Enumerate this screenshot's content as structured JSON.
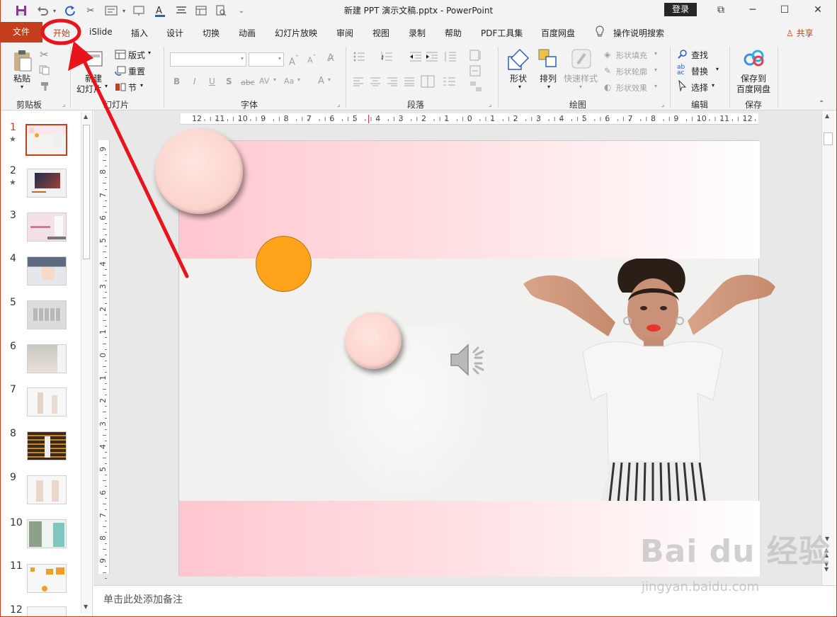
{
  "window": {
    "title": "新建 PPT 演示文稿.pptx  -  PowerPoint",
    "login": "登录",
    "controls": {
      "restore": "⧉",
      "minimize": "─",
      "maximize": "☐",
      "close": "✕"
    }
  },
  "quick_access": {
    "save": "save-icon",
    "undo": "undo-icon",
    "redo": "repeat-icon"
  },
  "tabs": [
    "文件",
    "开始",
    "iSlide",
    "插入",
    "设计",
    "切换",
    "动画",
    "幻灯片放映",
    "审阅",
    "视图",
    "录制",
    "帮助",
    "PDF工具集",
    "百度网盘"
  ],
  "search_hint": "操作说明搜索",
  "share": "共享",
  "ribbon": {
    "clipboard": {
      "label": "剪贴板",
      "paste": "粘贴"
    },
    "slides": {
      "label": "幻灯片",
      "new_slide_1": "新建",
      "new_slide_2": "幻灯片",
      "layout": "版式",
      "reset": "重置",
      "section": "节"
    },
    "font": {
      "label": "字体",
      "bold": "B",
      "italic": "I",
      "underline": "U",
      "shadow": "S",
      "strike": "abc",
      "spacing": "AV",
      "case": "Aa",
      "color": "A"
    },
    "paragraph": {
      "label": "段落"
    },
    "drawing": {
      "label": "绘图",
      "shape": "形状",
      "arrange": "排列",
      "quick_style": "快速样式",
      "fill": "形状填充",
      "outline": "形状轮廓",
      "effect": "形状效果"
    },
    "editing": {
      "label": "编辑",
      "find": "查找",
      "replace": "替换",
      "select": "选择"
    },
    "save": {
      "label": "保存",
      "save_to_1": "保存到",
      "save_to_2": "百度网盘"
    }
  },
  "slides_panel": [
    {
      "num": "1",
      "star": "★"
    },
    {
      "num": "2",
      "star": "★"
    },
    {
      "num": "3"
    },
    {
      "num": "4"
    },
    {
      "num": "5"
    },
    {
      "num": "6"
    },
    {
      "num": "7"
    },
    {
      "num": "8"
    },
    {
      "num": "9"
    },
    {
      "num": "10"
    },
    {
      "num": "11"
    },
    {
      "num": "12"
    }
  ],
  "ruler_h": [
    "12",
    "11",
    "10",
    "9",
    "8",
    "7",
    "6",
    "5",
    "4",
    "3",
    "2",
    "1",
    "0",
    "1",
    "2",
    "3",
    "4",
    "5",
    "6",
    "7",
    "8",
    "9",
    "10",
    "11",
    "12"
  ],
  "ruler_v": [
    "9",
    "8",
    "7",
    "6",
    "5",
    "4",
    "3",
    "2",
    "1",
    "0",
    "1",
    "2",
    "3",
    "4",
    "5",
    "6",
    "7",
    "8",
    "9"
  ],
  "notes_placeholder": "单击此处添加备注",
  "watermark": {
    "brand": "Bai du 经验",
    "url": "jingyan.baidu.com"
  },
  "colors": {
    "accent": "#c43e1c",
    "annotation": "#e8141c",
    "orange_circle": "#ffa31a"
  }
}
